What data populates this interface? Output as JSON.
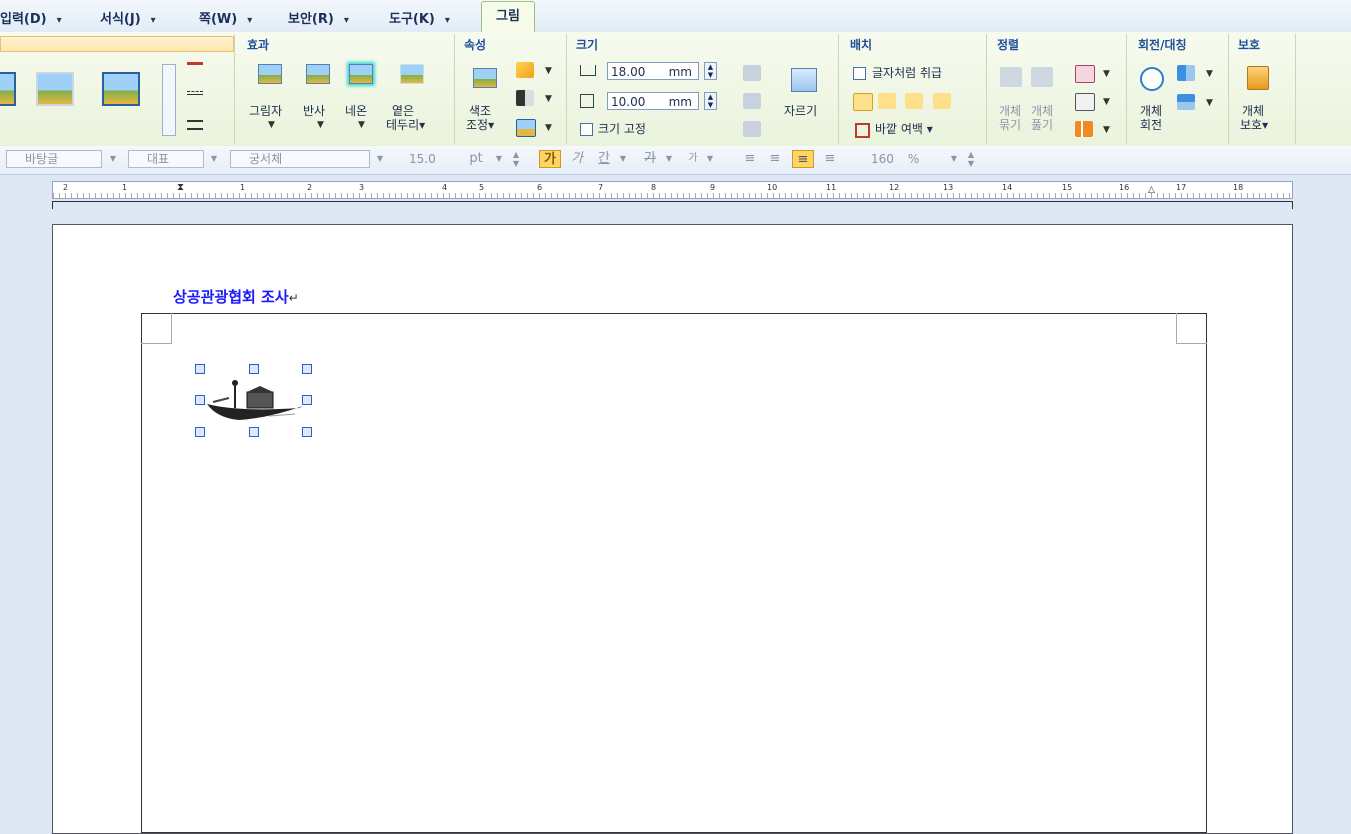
{
  "menubar": {
    "items": [
      {
        "label": "입력(D)"
      },
      {
        "label": "서식(J)"
      },
      {
        "label": "쪽(W)"
      },
      {
        "label": "보안(R)"
      },
      {
        "label": "도구(K)"
      }
    ],
    "active_tab": "그림",
    "dropdown_glyph": "▾"
  },
  "ribbon": {
    "groups": {
      "effects": "효과",
      "attributes": "속성",
      "size": "크기",
      "arrange": "배치",
      "align": "정렬",
      "rotate": "회전/대칭",
      "protect": "보호"
    },
    "effects": {
      "shadow": "그림자",
      "reflection": "반사",
      "neon": "네온",
      "soft_edge_1": "옅은",
      "soft_edge_2": "테두리▾"
    },
    "attributes": {
      "color_adjust_1": "색조",
      "color_adjust_2": "조정▾"
    },
    "size": {
      "width_value": "18.00",
      "width_unit": "mm",
      "height_value": "10.00",
      "height_unit": "mm",
      "fix_size": "크기 고정",
      "crop": "자르기"
    },
    "arrange": {
      "treat_as_char": "글자처럼 취급",
      "outer_margin": "바깥 여백 ▾"
    },
    "align": {
      "group_1": "개체",
      "group_2": "묶기",
      "ungroup_1": "개체",
      "ungroup_2": "풀기"
    },
    "rotate": {
      "label_1": "개체",
      "label_2": "회전"
    },
    "protect": {
      "label_1": "개체",
      "label_2": "보호▾"
    }
  },
  "format_bar": {
    "style": "바탕글",
    "lang": "대표",
    "font": "궁서체",
    "size": "15.0",
    "size_unit": "pt",
    "bold": "가",
    "italic": "가",
    "underline": "간",
    "strike": "가",
    "super": "가",
    "line_spacing": "160",
    "line_spacing_unit": "%"
  },
  "ruler": {
    "marks": [
      "2",
      "1",
      "1",
      "2",
      "3",
      "4",
      "5",
      "6",
      "7",
      "8",
      "9",
      "10",
      "11",
      "12",
      "13",
      "14",
      "15",
      "16",
      "17",
      "18"
    ]
  },
  "document": {
    "heading": "상공관광협회 조사",
    "para_mark": "↵"
  },
  "colors": {
    "accent": "#1f4f9a",
    "heading": "#1a1aff",
    "ribbon_bg": "#eef6e2"
  }
}
